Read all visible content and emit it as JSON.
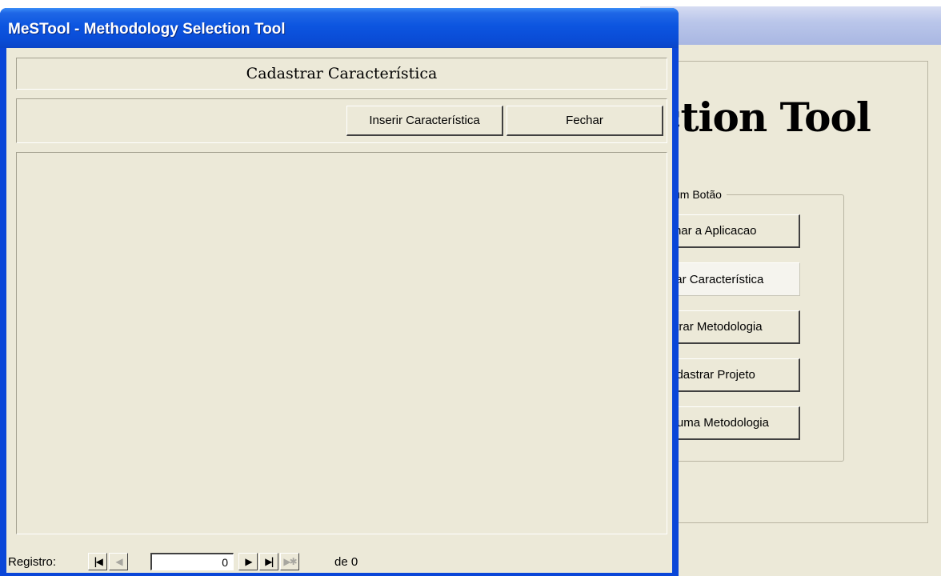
{
  "window": {
    "title": "MeSTool - Methodology Selection Tool"
  },
  "form": {
    "title": "Cadastrar Característica",
    "insert_label": "Inserir Característica",
    "close_label": "Fechar"
  },
  "navigation": {
    "record_label": "Registro:",
    "current_record": "0",
    "total_text": "de 0",
    "icons": [
      "first-record-icon",
      "previous-record-icon",
      "next-record-icon",
      "last-record-icon",
      "new-record-icon"
    ]
  },
  "background_menu": {
    "heading": "ction Tool",
    "group_legend": "um Botão",
    "buttons": [
      "char a Aplicacao",
      "strar Característica",
      "astrar Metodologia",
      "adastrar Projeto",
      "nar uma Metodologia"
    ]
  },
  "colors": {
    "titlebar_blue": "#0a4cd6",
    "window_face": "#ece9d8"
  }
}
